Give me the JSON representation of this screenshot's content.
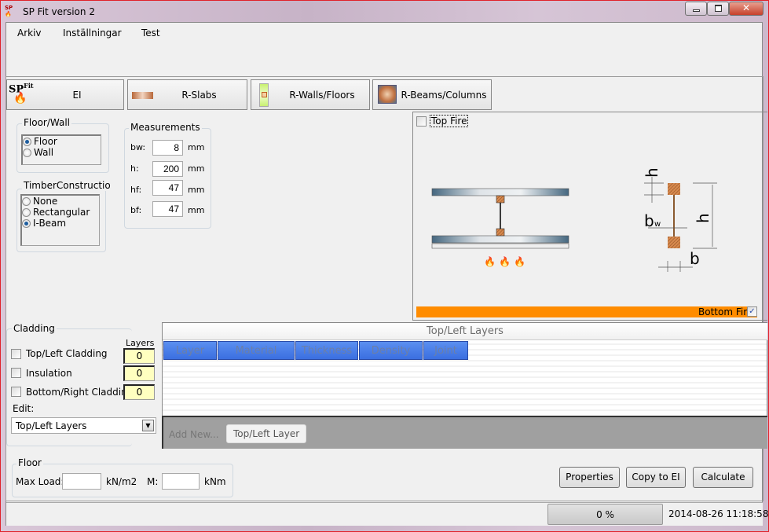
{
  "window": {
    "title": "SP Fit version 2",
    "controls": [
      "minimize",
      "maximize",
      "close"
    ]
  },
  "menu": [
    "Arkiv",
    "Inställningar",
    "Test"
  ],
  "tabs": [
    {
      "label": "EI",
      "icon": "sp-fit-logo-icon",
      "logo_text": "SP Fit"
    },
    {
      "label": "R-Slabs",
      "icon": "slab-icon"
    },
    {
      "label": "R-Walls/Floors",
      "icon": "wall-icon"
    },
    {
      "label": "R-Beams/Columns",
      "icon": "beam-icon"
    }
  ],
  "floor_wall": {
    "title": "Floor/Wall",
    "options": [
      {
        "label": "Floor",
        "selected": true
      },
      {
        "label": "Wall",
        "selected": false
      }
    ]
  },
  "timber": {
    "title": "TimberConstructio",
    "options": [
      {
        "label": "None",
        "selected": false
      },
      {
        "label": "Rectangular",
        "selected": false
      },
      {
        "label": "I-Beam",
        "selected": true
      }
    ]
  },
  "measurements": {
    "title": "Measurements",
    "rows": [
      {
        "label": "bw:",
        "value": "8",
        "unit": "mm"
      },
      {
        "label": "h:",
        "value": "200",
        "unit": "mm"
      },
      {
        "label": "hf:",
        "value": "47",
        "unit": "mm"
      },
      {
        "label": "bf:",
        "value": "47",
        "unit": "mm"
      }
    ]
  },
  "diagram": {
    "top_fire": {
      "label": "Top Fire",
      "checked": false
    },
    "bottom_fire": {
      "label": "Bottom Fire",
      "checked": true
    },
    "labels": {
      "hf": "h",
      "hf_sub": "f",
      "bw": "b",
      "bw_sub": "w",
      "h": "h",
      "b": "b"
    },
    "bar_color": "#ff8c00"
  },
  "cladding": {
    "title": "Cladding",
    "layers_header": "Layers",
    "rows": [
      {
        "label": "Top/Left Cladding",
        "checked": false,
        "layers": "0"
      },
      {
        "label": "Insulation",
        "checked": false,
        "layers": "0"
      },
      {
        "label": "Bottom/Right Cladding",
        "checked": false,
        "layers": "0"
      }
    ],
    "edit_label": "Edit:",
    "edit_value": "Top/Left Layers"
  },
  "grid": {
    "title": "Top/Left Layers",
    "columns": [
      "Layer",
      "Material",
      "Thickness",
      "Density",
      "Joint"
    ],
    "add_new": "Add New...",
    "add_button": "Top/Left Layer"
  },
  "floor": {
    "title": "Floor",
    "max_load_label": "Max Load:",
    "max_load_value": "",
    "max_load_unit": "kN/m2",
    "m_label": "M:",
    "m_value": "",
    "m_unit": "kNm"
  },
  "buttons": {
    "properties": "Properties",
    "copy": "Copy to EI",
    "calculate": "Calculate"
  },
  "status": {
    "progress_text": "0 %",
    "progress": 0,
    "timestamp": "2014-08-26 11:18:58"
  }
}
